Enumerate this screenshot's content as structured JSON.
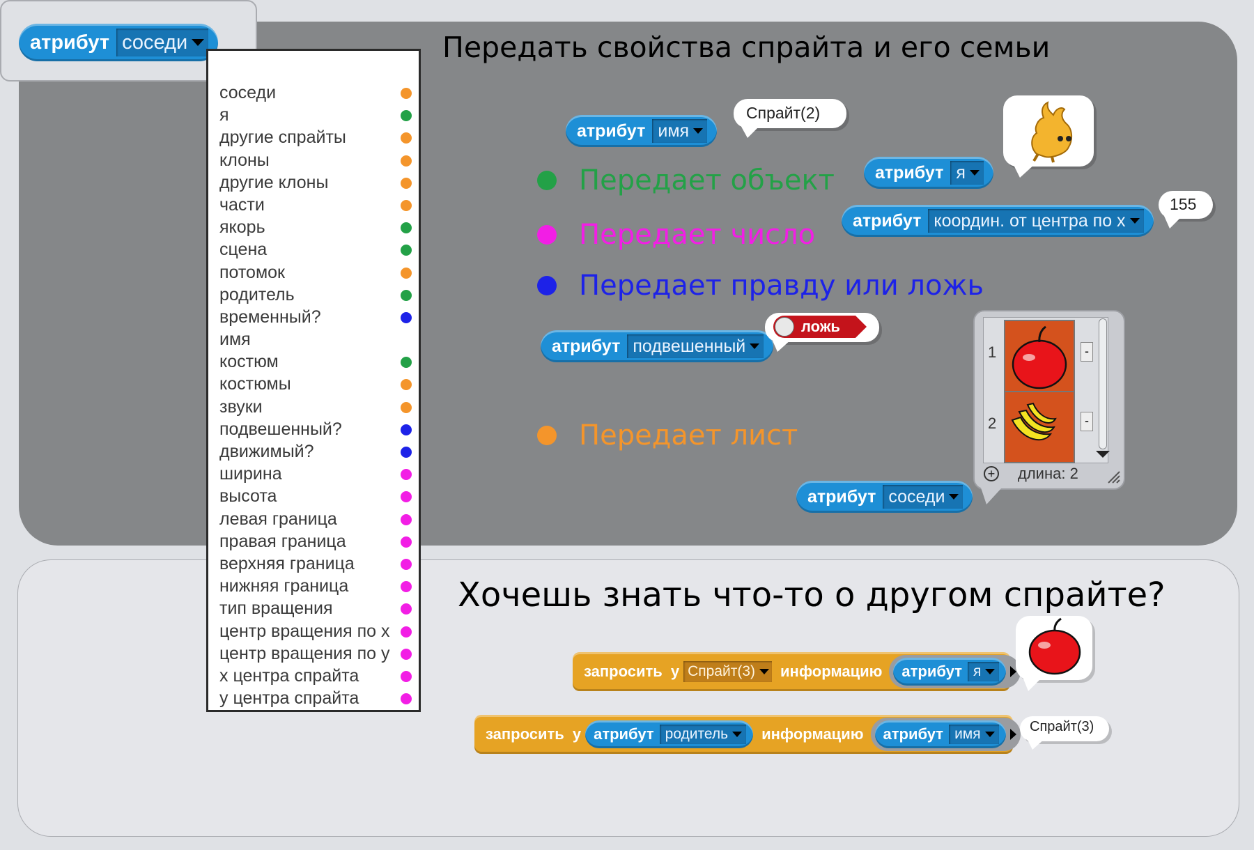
{
  "top_heading": "Передать свойства спрайта и его семьи",
  "bottom_heading": "Хочешь знать что-то о другом спрайте?",
  "menu_block": {
    "label": "атрибут",
    "selected": "соседи"
  },
  "menu_items": [
    {
      "label": "соседи",
      "color": "#f4952b"
    },
    {
      "label": "я",
      "color": "#23a147"
    },
    {
      "label": "другие спрайты",
      "color": "#f4952b"
    },
    {
      "label": "клоны",
      "color": "#f4952b"
    },
    {
      "label": "другие клоны",
      "color": "#f4952b"
    },
    {
      "label": "части",
      "color": "#f4952b"
    },
    {
      "label": "якорь",
      "color": "#23a147"
    },
    {
      "label": "сцена",
      "color": "#23a147"
    },
    {
      "label": "потомок",
      "color": "#f4952b"
    },
    {
      "label": "родитель",
      "color": "#23a147"
    },
    {
      "label": "временный?",
      "color": "#1d22e8"
    },
    {
      "label": "имя",
      "color": ""
    },
    {
      "label": "костюм",
      "color": "#23a147"
    },
    {
      "label": "костюмы",
      "color": "#f4952b"
    },
    {
      "label": "звуки",
      "color": "#f4952b"
    },
    {
      "label": "подвешенный?",
      "color": "#1d22e8"
    },
    {
      "label": "движимый?",
      "color": "#1d22e8"
    },
    {
      "label": "ширина",
      "color": "#f21ee5"
    },
    {
      "label": "высота",
      "color": "#f21ee5"
    },
    {
      "label": "левая граница",
      "color": "#f21ee5"
    },
    {
      "label": "правая граница",
      "color": "#f21ee5"
    },
    {
      "label": "верхняя граница",
      "color": "#f21ee5"
    },
    {
      "label": "нижняя граница",
      "color": "#f21ee5"
    },
    {
      "label": "тип вращения",
      "color": "#f21ee5"
    },
    {
      "label": "центр вращения по х",
      "color": "#f21ee5"
    },
    {
      "label": "центр вращения по у",
      "color": "#f21ee5"
    },
    {
      "label": "х центра спрайта",
      "color": "#f21ee5"
    },
    {
      "label": "у центра спрайта",
      "color": "#f21ee5"
    }
  ],
  "legend": {
    "object": {
      "text": "Передает объект",
      "color": "#23a147"
    },
    "number": {
      "text": "Передает число",
      "color": "#f21ee5"
    },
    "boolean": {
      "text": "Передает правду или ложь",
      "color": "#1d22e8"
    },
    "list": {
      "text": "Передает лист",
      "color": "#f4952b"
    }
  },
  "examples": {
    "name": {
      "label": "атрибут",
      "option": "имя",
      "result": "Спрайт(2)"
    },
    "me": {
      "label": "атрибут",
      "option": "я"
    },
    "center_x": {
      "label": "атрибут",
      "option": "координ. от центра по х",
      "result": "155"
    },
    "hanging": {
      "label": "атрибут",
      "option": "подвешенный",
      "result": "ложь"
    },
    "neighbors": {
      "label": "атрибут",
      "option": "соседи"
    }
  },
  "list_watcher": {
    "indices": [
      "1",
      "2"
    ],
    "length_label": "длина: 2",
    "minus": "-",
    "plus": "+"
  },
  "ask_blocks": {
    "first": {
      "ask": "запросить",
      "of": "у",
      "sprite": "Спрайт(3)",
      "info": "информацию",
      "attr_label": "атрибут",
      "attr_option": "я"
    },
    "second": {
      "ask": "запросить",
      "of": "у",
      "inner_label": "атрибут",
      "inner_option": "родитель",
      "info": "информацию",
      "attr_label": "атрибут",
      "attr_option": "имя",
      "result": "Спрайт(3)"
    }
  }
}
